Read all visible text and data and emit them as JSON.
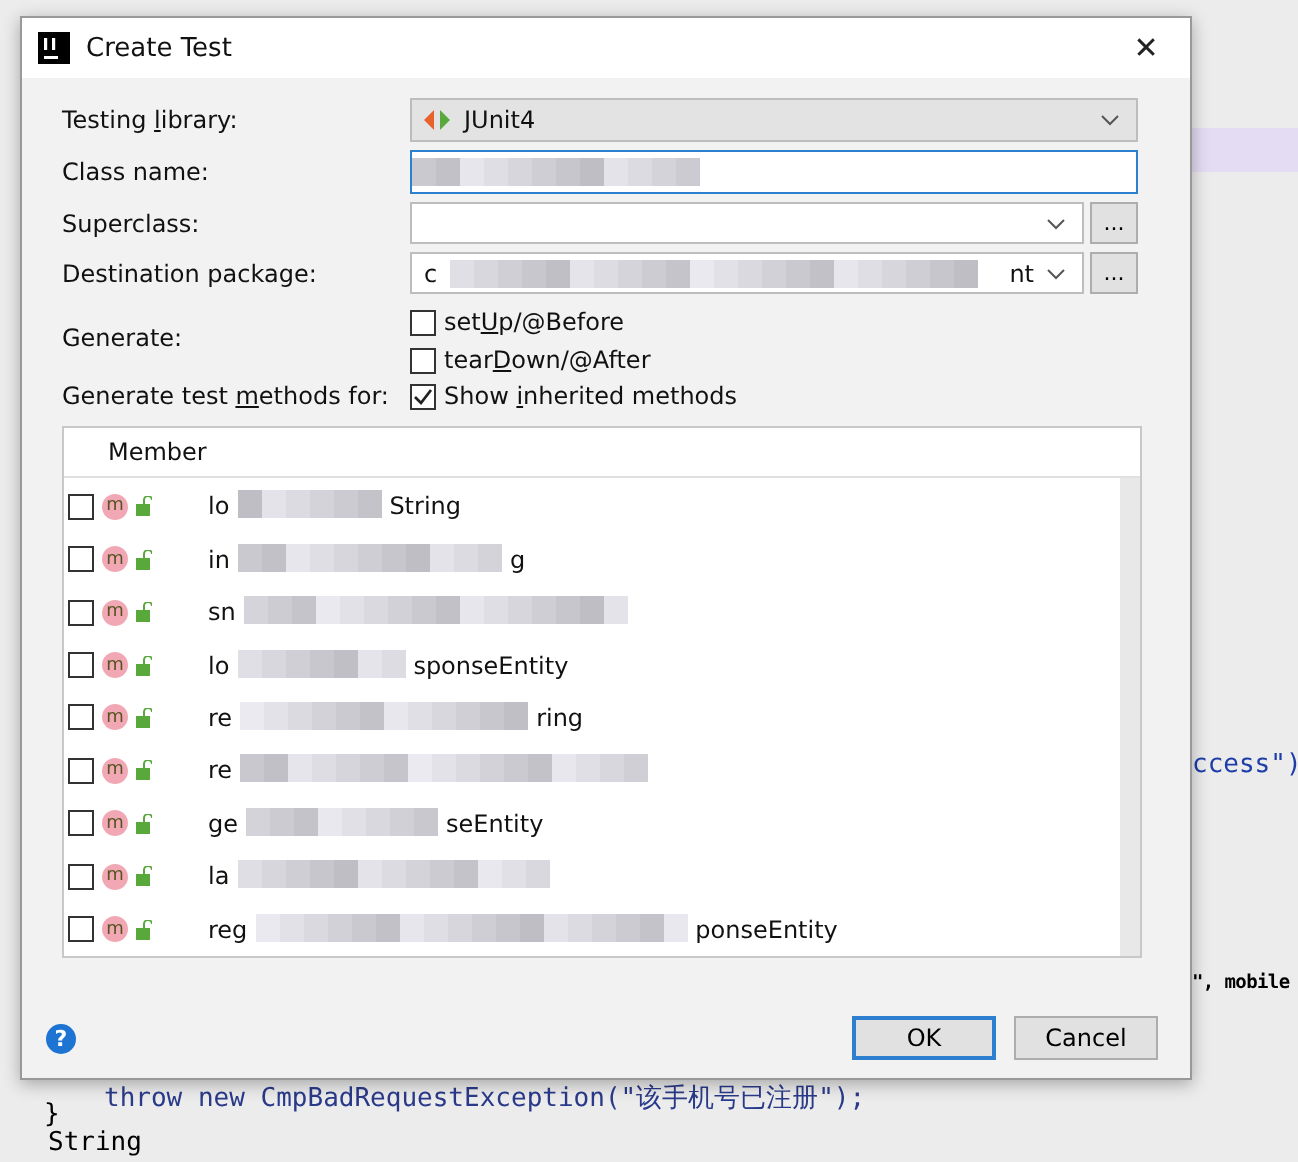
{
  "editor": {
    "lines": [
      {
        "kind": "right",
        "text": "ccess\")"
      },
      {
        "kind": "right2",
        "text": "\", mobile"
      },
      {
        "kind": "indent",
        "text": "throw new CmpBadRequestException(\"该手机号已注册\");"
      },
      {
        "kind": "plain",
        "text": "}"
      },
      {
        "kind": "plain2",
        "text": "String"
      }
    ]
  },
  "window": {
    "title": "Create Test",
    "close": "✕"
  },
  "form": {
    "testing_library": {
      "label": {
        "before": "Testing ",
        "mnemonic": "l",
        "after": "ibrary:"
      },
      "value": "JUnit4"
    },
    "class_name": {
      "label": "Class name:",
      "redacted": true
    },
    "superclass": {
      "label": "Superclass:",
      "browse": "..."
    },
    "destination_package": {
      "label": "Destination package:",
      "prefix": "c",
      "suffix": "nt",
      "redacted": true,
      "browse": "..."
    },
    "generate": {
      "label": "Generate:",
      "options": [
        {
          "label": {
            "before": "set",
            "mnemonic": "U",
            "after": "p/@Before"
          },
          "checked": false
        },
        {
          "label": {
            "before": "tear",
            "mnemonic": "D",
            "after": "own/@After"
          },
          "checked": false
        }
      ]
    },
    "methods": {
      "label": {
        "before": "Generate test ",
        "mnemonic": "m",
        "after": "ethods for:"
      },
      "show_inherited": {
        "label": {
          "before": "Show ",
          "mnemonic": "i",
          "after": "nherited methods"
        },
        "checked": true
      }
    }
  },
  "table": {
    "columns": [
      "Member"
    ],
    "rows": [
      {
        "checked": false,
        "badge": "m",
        "prefix": "lo",
        "suffix": "String"
      },
      {
        "checked": false,
        "badge": "m",
        "prefix": "in",
        "suffix": "g"
      },
      {
        "checked": false,
        "badge": "m",
        "prefix": "sn"
      },
      {
        "checked": false,
        "badge": "m",
        "prefix": "lo",
        "suffix": "sponseEntity"
      },
      {
        "checked": false,
        "badge": "m",
        "prefix": "re",
        "suffix": "ring"
      },
      {
        "checked": false,
        "badge": "m",
        "prefix": "re"
      },
      {
        "checked": false,
        "badge": "m",
        "prefix": "ge",
        "suffix": "seEntity"
      },
      {
        "checked": false,
        "badge": "m",
        "prefix": "la"
      },
      {
        "checked": false,
        "badge": "m",
        "prefix": "reg",
        "suffix": "ponseEntity"
      }
    ]
  },
  "footer": {
    "help": "?",
    "buttons": [
      {
        "label": "OK",
        "selected": true
      },
      {
        "label": "Cancel",
        "selected": false
      }
    ]
  }
}
